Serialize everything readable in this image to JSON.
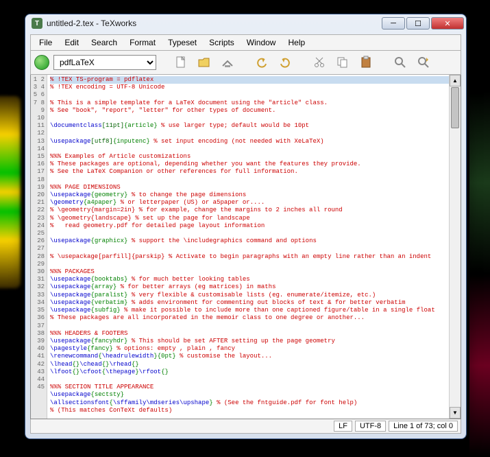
{
  "window": {
    "title": "untitled-2.tex - TeXworks"
  },
  "menu": {
    "file": "File",
    "edit": "Edit",
    "search": "Search",
    "format": "Format",
    "typeset": "Typeset",
    "scripts": "Scripts",
    "window": "Window",
    "help": "Help"
  },
  "toolbar": {
    "format_selected": "pdfLaTeX"
  },
  "status": {
    "lineend": "LF",
    "encoding": "UTF-8",
    "position": "Line 1 of 73; col 0"
  },
  "gutter_lines": 45,
  "code_lines": [
    {
      "t": "red",
      "hl": true,
      "text": "% !TEX TS-program = pdflatex"
    },
    {
      "t": "red",
      "text": "% !TEX encoding = UTF-8 Unicode"
    },
    {
      "t": "",
      "text": ""
    },
    {
      "t": "red",
      "text": "% This is a simple template for a LaTeX document using the \"article\" class."
    },
    {
      "t": "red",
      "text": "% See \"book\", \"report\", \"letter\" for other types of document."
    },
    {
      "t": "",
      "text": ""
    },
    {
      "t": "mix",
      "segs": [
        [
          "blue",
          "\\documentclass"
        ],
        [
          "dgreen",
          "[11pt]"
        ],
        [
          "green",
          "{article}"
        ],
        [
          "red",
          " % use larger type; default would be 10pt"
        ]
      ]
    },
    {
      "t": "",
      "text": ""
    },
    {
      "t": "mix",
      "segs": [
        [
          "blue",
          "\\usepackage"
        ],
        [
          "dgreen",
          "[utf8]"
        ],
        [
          "green",
          "{inputenc}"
        ],
        [
          "red",
          " % set input encoding (not needed with XeLaTeX)"
        ]
      ]
    },
    {
      "t": "",
      "text": ""
    },
    {
      "t": "red",
      "text": "%%% Examples of Article customizations"
    },
    {
      "t": "red",
      "text": "% These packages are optional, depending whether you want the features they provide."
    },
    {
      "t": "red",
      "text": "% See the LaTeX Companion or other references for full information."
    },
    {
      "t": "",
      "text": ""
    },
    {
      "t": "red",
      "text": "%%% PAGE DIMENSIONS"
    },
    {
      "t": "mix",
      "segs": [
        [
          "blue",
          "\\usepackage"
        ],
        [
          "green",
          "{geometry}"
        ],
        [
          "red",
          " % to change the page dimensions"
        ]
      ]
    },
    {
      "t": "mix",
      "segs": [
        [
          "blue",
          "\\geometry"
        ],
        [
          "green",
          "{a4paper}"
        ],
        [
          "red",
          " % or letterpaper (US) or a5paper or...."
        ]
      ]
    },
    {
      "t": "red",
      "text": "% \\geometry{margin=2in} % for example, change the margins to 2 inches all round"
    },
    {
      "t": "red",
      "text": "% \\geometry{landscape} % set up the page for landscape"
    },
    {
      "t": "red",
      "text": "%   read geometry.pdf for detailed page layout information"
    },
    {
      "t": "",
      "text": ""
    },
    {
      "t": "mix",
      "segs": [
        [
          "blue",
          "\\usepackage"
        ],
        [
          "green",
          "{graphicx}"
        ],
        [
          "red",
          " % support the \\includegraphics command and options"
        ]
      ]
    },
    {
      "t": "",
      "text": ""
    },
    {
      "t": "red",
      "text": "% \\usepackage[parfill]{parskip} % Activate to begin paragraphs with an empty line rather than an indent"
    },
    {
      "t": "",
      "text": ""
    },
    {
      "t": "red",
      "text": "%%% PACKAGES"
    },
    {
      "t": "mix",
      "segs": [
        [
          "blue",
          "\\usepackage"
        ],
        [
          "green",
          "{booktabs}"
        ],
        [
          "red",
          " % for much better looking tables"
        ]
      ]
    },
    {
      "t": "mix",
      "segs": [
        [
          "blue",
          "\\usepackage"
        ],
        [
          "green",
          "{array}"
        ],
        [
          "red",
          " % for better arrays (eg matrices) in maths"
        ]
      ]
    },
    {
      "t": "mix",
      "segs": [
        [
          "blue",
          "\\usepackage"
        ],
        [
          "green",
          "{paralist}"
        ],
        [
          "red",
          " % very flexible & customisable lists (eg. enumerate/itemize, etc.)"
        ]
      ]
    },
    {
      "t": "mix",
      "segs": [
        [
          "blue",
          "\\usepackage"
        ],
        [
          "green",
          "{verbatim}"
        ],
        [
          "red",
          " % adds environment for commenting out blocks of text & for better verbatim"
        ]
      ]
    },
    {
      "t": "mix",
      "segs": [
        [
          "blue",
          "\\usepackage"
        ],
        [
          "green",
          "{subfig}"
        ],
        [
          "red",
          " % make it possible to include more than one captioned figure/table in a single float"
        ]
      ]
    },
    {
      "t": "red",
      "text": "% These packages are all incorporated in the memoir class to one degree or another..."
    },
    {
      "t": "",
      "text": ""
    },
    {
      "t": "red",
      "text": "%%% HEADERS & FOOTERS"
    },
    {
      "t": "mix",
      "segs": [
        [
          "blue",
          "\\usepackage"
        ],
        [
          "green",
          "{fancyhdr}"
        ],
        [
          "red",
          " % This should be set AFTER setting up the page geometry"
        ]
      ]
    },
    {
      "t": "mix",
      "segs": [
        [
          "blue",
          "\\pagestyle"
        ],
        [
          "green",
          "{fancy}"
        ],
        [
          "red",
          " % options: empty , plain , fancy"
        ]
      ]
    },
    {
      "t": "mix",
      "segs": [
        [
          "blue",
          "\\renewcommand"
        ],
        [
          "green",
          "{"
        ],
        [
          "blue",
          "\\headrulewidth"
        ],
        [
          "green",
          "}{0pt}"
        ],
        [
          "red",
          " % customise the layout..."
        ]
      ]
    },
    {
      "t": "mix",
      "segs": [
        [
          "blue",
          "\\lhead"
        ],
        [
          "green",
          "{}"
        ],
        [
          "blue",
          "\\chead"
        ],
        [
          "green",
          "{}"
        ],
        [
          "blue",
          "\\rhead"
        ],
        [
          "green",
          "{}"
        ]
      ]
    },
    {
      "t": "mix",
      "segs": [
        [
          "blue",
          "\\lfoot"
        ],
        [
          "green",
          "{}"
        ],
        [
          "blue",
          "\\cfoot"
        ],
        [
          "green",
          "{"
        ],
        [
          "blue",
          "\\thepage"
        ],
        [
          "green",
          "}"
        ],
        [
          "blue",
          "\\rfoot"
        ],
        [
          "green",
          "{}"
        ]
      ]
    },
    {
      "t": "",
      "text": ""
    },
    {
      "t": "red",
      "text": "%%% SECTION TITLE APPEARANCE"
    },
    {
      "t": "mix",
      "segs": [
        [
          "blue",
          "\\usepackage"
        ],
        [
          "green",
          "{sectsty}"
        ]
      ]
    },
    {
      "t": "mix",
      "segs": [
        [
          "blue",
          "\\allsectionsfont"
        ],
        [
          "green",
          "{"
        ],
        [
          "blue",
          "\\sffamily\\mdseries\\upshape"
        ],
        [
          "green",
          "}"
        ],
        [
          "red",
          " % (See the fntguide.pdf for font help)"
        ]
      ]
    },
    {
      "t": "red",
      "text": "% (This matches ConTeXt defaults)"
    },
    {
      "t": "",
      "text": ""
    }
  ]
}
